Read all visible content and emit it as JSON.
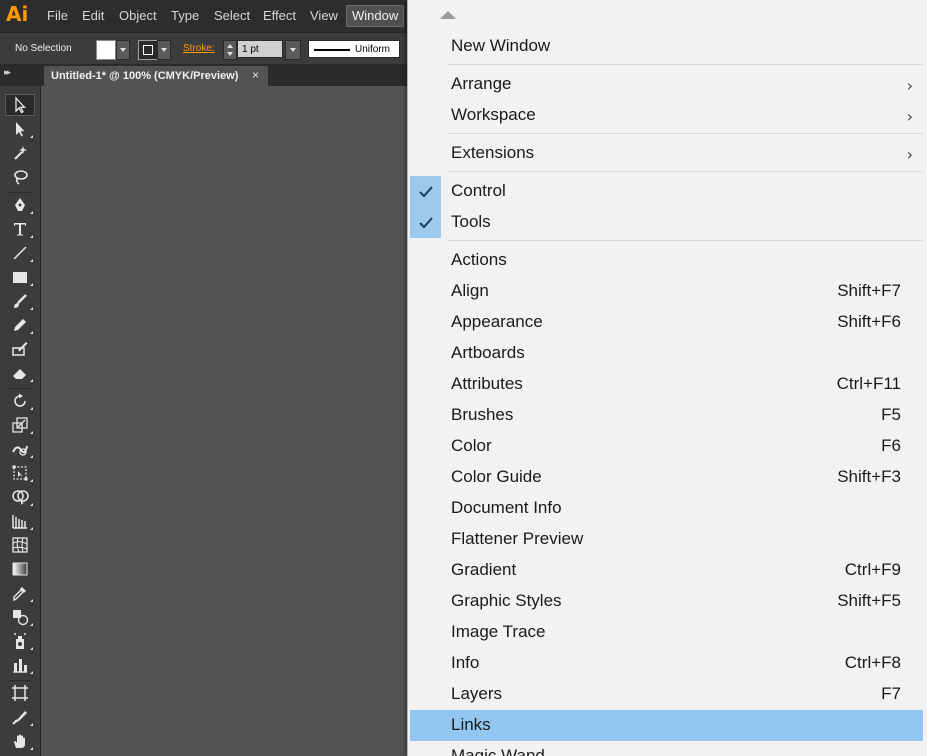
{
  "app": {
    "logo": "Ai"
  },
  "menubar": {
    "items": [
      "File",
      "Edit",
      "Object",
      "Type",
      "Select",
      "Effect",
      "View",
      "Window"
    ]
  },
  "control": {
    "selection_status": "No Selection",
    "stroke_label": "Stroke:",
    "stroke_weight": "1 pt",
    "profile": "Uniform"
  },
  "document": {
    "tab_title": "Untitled-1* @ 100% (CMYK/Preview)",
    "close_glyph": "×"
  },
  "window_menu": {
    "items": [
      {
        "label": "New Window"
      },
      {
        "label": "Arrange",
        "submenu": true
      },
      {
        "label": "Workspace",
        "submenu": true
      },
      {
        "label": "Extensions",
        "submenu": true
      },
      {
        "label": "Control",
        "checked": true
      },
      {
        "label": "Tools",
        "checked": true
      },
      {
        "label": "Actions"
      },
      {
        "label": "Align",
        "shortcut": "Shift+F7"
      },
      {
        "label": "Appearance",
        "shortcut": "Shift+F6"
      },
      {
        "label": "Artboards"
      },
      {
        "label": "Attributes",
        "shortcut": "Ctrl+F11"
      },
      {
        "label": "Brushes",
        "shortcut": "F5"
      },
      {
        "label": "Color",
        "shortcut": "F6"
      },
      {
        "label": "Color Guide",
        "shortcut": "Shift+F3"
      },
      {
        "label": "Document Info"
      },
      {
        "label": "Flattener Preview"
      },
      {
        "label": "Gradient",
        "shortcut": "Ctrl+F9"
      },
      {
        "label": "Graphic Styles",
        "shortcut": "Shift+F5"
      },
      {
        "label": "Image Trace"
      },
      {
        "label": "Info",
        "shortcut": "Ctrl+F8"
      },
      {
        "label": "Layers",
        "shortcut": "F7"
      },
      {
        "label": "Links",
        "highlighted": true
      },
      {
        "label": "Magic Wand"
      }
    ]
  },
  "tools": [
    "selection-tool-icon",
    "direct-selection-tool-icon",
    "magic-wand-tool-icon",
    "lasso-tool-icon",
    "pen-tool-icon",
    "type-tool-icon",
    "line-segment-tool-icon",
    "rectangle-tool-icon",
    "paintbrush-tool-icon",
    "pencil-tool-icon",
    "blob-brush-tool-icon",
    "eraser-tool-icon",
    "rotate-tool-icon",
    "scale-tool-icon",
    "warp-tool-icon",
    "free-transform-tool-icon",
    "shape-builder-tool-icon",
    "perspective-grid-tool-icon",
    "mesh-tool-icon",
    "gradient-tool-icon",
    "eyedropper-tool-icon",
    "blend-tool-icon",
    "symbol-sprayer-tool-icon",
    "column-graph-tool-icon",
    "artboard-tool-icon",
    "slice-tool-icon",
    "hand-tool-icon"
  ],
  "colors": {
    "accent_orange": "#ff9a00",
    "menu_highlight": "#92c5f0",
    "check_bg": "#9dc9ee"
  }
}
